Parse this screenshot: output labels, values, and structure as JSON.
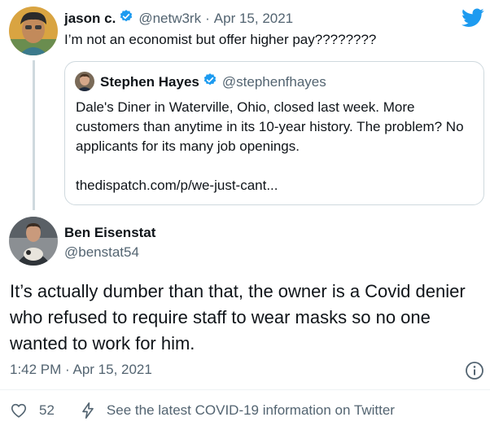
{
  "parent_tweet": {
    "author_name": "jason c.",
    "author_handle": "@netw3rk",
    "separator": "·",
    "date": "Apr 15, 2021",
    "text": "I’m not an economist but offer higher pay????????"
  },
  "quoted_tweet": {
    "author_name": "Stephen Hayes",
    "author_handle": "@stephenfhayes",
    "text": "Dale's Diner in Waterville, Ohio, closed last week. More customers than anytime in its 10-year history. The problem? No applicants for its many job openings.",
    "link": "thedispatch.com/p/we-just-cant..."
  },
  "main_tweet": {
    "author_name": "Ben Eisenstat",
    "author_handle": "@benstat54",
    "text": "It’s actually dumber than that, the owner is a Covid denier who refused to require staff to wear masks so no one wanted to work for him.",
    "timestamp": "1:42 PM · Apr 15, 2021"
  },
  "actions": {
    "like_count": "52",
    "covid_link": "See the latest COVID-19 information on Twitter"
  },
  "icons": {
    "logo": "twitter-bird-icon",
    "verified": "verified-badge-icon",
    "info": "info-icon",
    "like": "heart-icon",
    "covid": "lightning-bolt-icon"
  },
  "colors": {
    "brand": "#1d9bf0",
    "text_primary": "#0f1419",
    "text_secondary": "#536471",
    "border": "#cfd9de"
  }
}
